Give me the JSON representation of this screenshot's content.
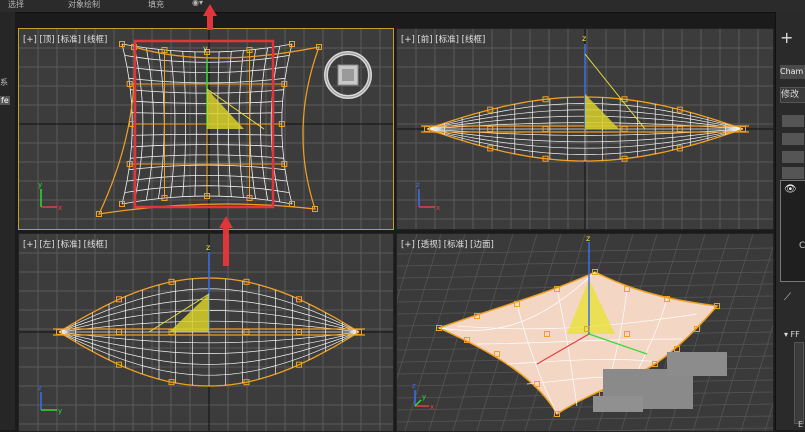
{
  "topbar": {
    "item1": "选择",
    "item2": "对象绘制",
    "item3": "填充"
  },
  "leftstrip": {
    "item1": "系",
    "item2": "fe"
  },
  "viewports": {
    "top": {
      "label": "[+] [顶] [标准] [线框]"
    },
    "front": {
      "label": "[+] [前] [标准] [线框]"
    },
    "left": {
      "label": "[+] [左] [标准] [线框]"
    },
    "persp": {
      "label": "[+] [透视] [标准] [边面]"
    }
  },
  "rightpanel": {
    "plus": "+",
    "cham_label": "Cham",
    "mod_label": "修改",
    "eye": "👁",
    "c_label": "C",
    "ff_label": "▾ FF",
    "e_label": "E"
  },
  "colors": {
    "viewport_bg": "#3c3c3c",
    "grid": "#5a5a5a",
    "mesh_white": "#f2f2f2",
    "mesh_orange": "#f0a020",
    "highlight_red": "#e0353a",
    "active_border": "#c79c2a",
    "surface_pink": "#f3d6c4"
  }
}
